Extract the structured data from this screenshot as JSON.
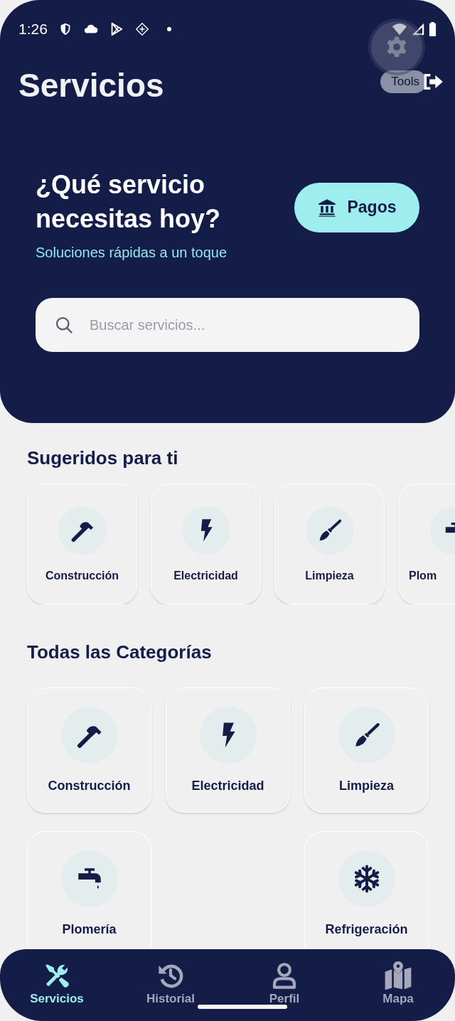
{
  "status_bar": {
    "time": "1:26"
  },
  "header": {
    "title": "Servicios",
    "tools_label": "Tools",
    "headline": "¿Qué servicio necesitas hoy?",
    "subtitle": "Soluciones rápidas a un toque",
    "pay_button": "Pagos",
    "search": {
      "placeholder": "Buscar servicios..."
    }
  },
  "suggested": {
    "title": "Sugeridos para ti",
    "items": [
      {
        "label": "Construcción"
      },
      {
        "label": "Electricidad"
      },
      {
        "label": "Limpieza"
      },
      {
        "label": "Plom"
      }
    ]
  },
  "categories": {
    "title": "Todas las Categorías",
    "rows": [
      [
        {
          "label": "Construcción"
        },
        {
          "label": "Electricidad"
        },
        {
          "label": "Limpieza"
        }
      ],
      [
        {
          "label": "Plomería"
        },
        null,
        {
          "label": "Refrigeración"
        }
      ]
    ]
  },
  "bottom_nav": [
    {
      "label": "Servicios",
      "selected": true
    },
    {
      "label": "Historial",
      "selected": false
    },
    {
      "label": "Perfil",
      "selected": false
    },
    {
      "label": "Mapa",
      "selected": false
    }
  ]
}
